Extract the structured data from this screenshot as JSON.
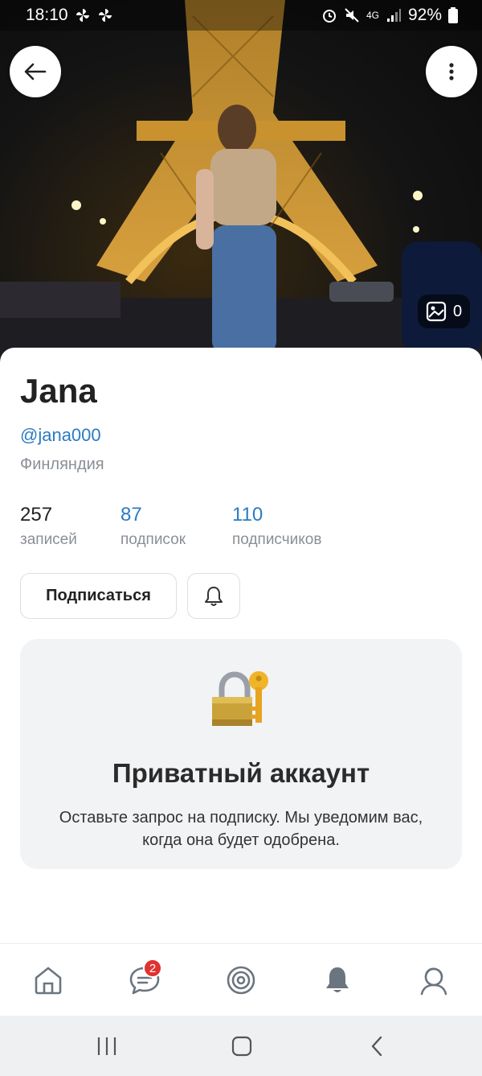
{
  "status_bar": {
    "time": "18:10",
    "network": "4G",
    "battery": "92%",
    "icons": [
      "pinwheel-icon",
      "pinwheel-icon",
      "alarm-icon",
      "mute-icon",
      "signal-icon",
      "battery-icon"
    ]
  },
  "cover": {
    "photo_count": "0"
  },
  "profile": {
    "name": "Jana",
    "username": "@jana000",
    "location": "Финляндия",
    "stats": {
      "posts": {
        "value": "257",
        "label": "записей"
      },
      "following": {
        "value": "87",
        "label": "подписок"
      },
      "followers": {
        "value": "110",
        "label": "подписчиков"
      }
    },
    "subscribe_label": "Подписаться"
  },
  "private_account": {
    "title": "Приватный аккаунт",
    "text": "Оставьте запрос на подписку. Мы уведомим вас, когда она будет одобрена."
  },
  "bottom_nav": {
    "items": [
      "home-icon",
      "messages-icon",
      "discover-icon",
      "notifications-icon",
      "profile-icon"
    ],
    "messages_badge": "2"
  },
  "colors": {
    "accent": "#2a7bc4",
    "muted": "#8a8f96",
    "badge": "#e0322f",
    "panel": "#f2f3f5"
  }
}
